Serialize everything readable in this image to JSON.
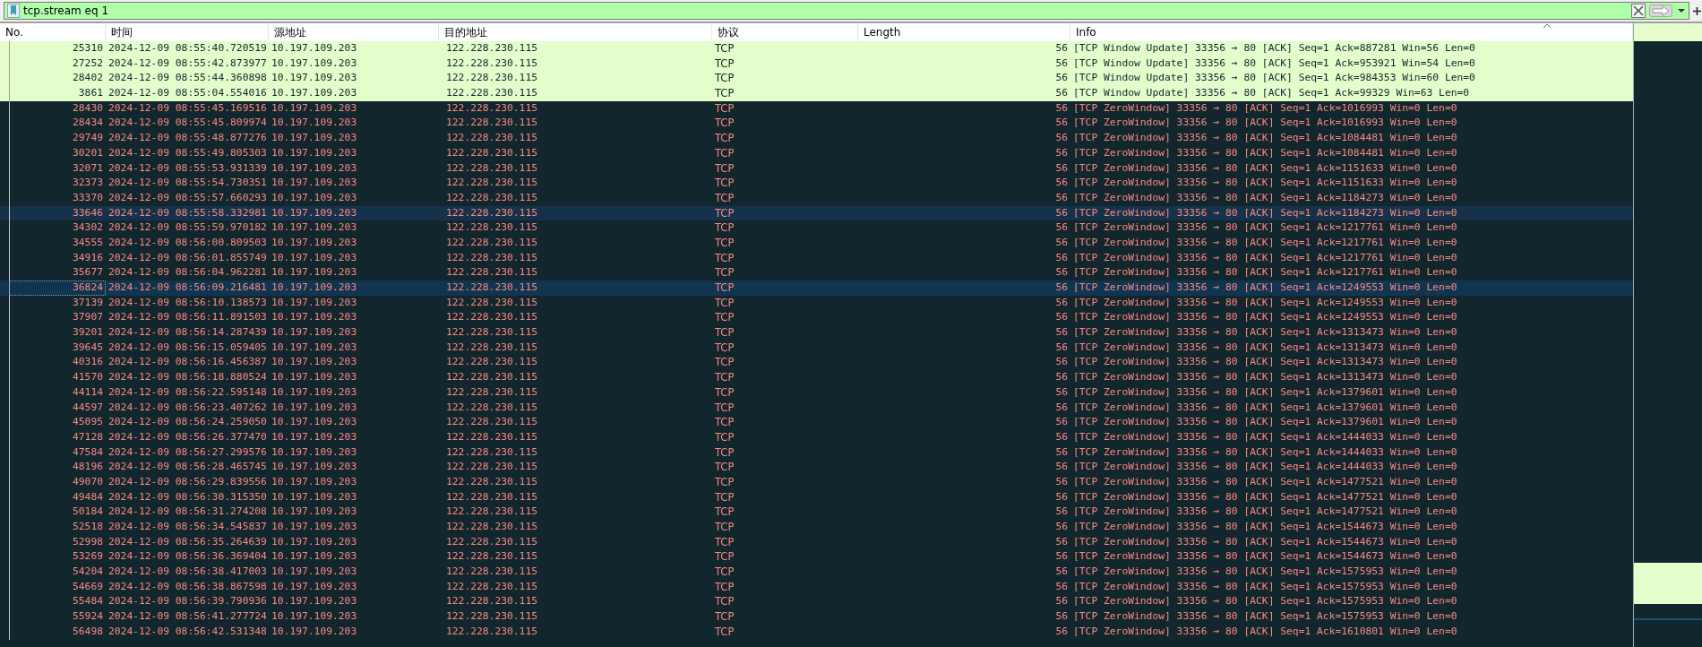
{
  "filter": {
    "value": "tcp.stream eq 1"
  },
  "columns": [
    {
      "label": "No.",
      "sorted": false
    },
    {
      "label": "时间",
      "sorted": false
    },
    {
      "label": "源地址",
      "sorted": false
    },
    {
      "label": "目的地址",
      "sorted": false
    },
    {
      "label": "协议",
      "sorted": false
    },
    {
      "label": "Length",
      "sorted": false
    },
    {
      "label": "Info",
      "sorted": true
    }
  ],
  "rows": [
    {
      "no": "25310",
      "time": "2024-12-09 08:55:40.720519",
      "source": "10.197.109.203",
      "destination": "122.228.230.115",
      "protocol": "TCP",
      "length": "56",
      "info": "[TCP Window Update] 33356 → 80 [ACK] Seq=1 Ack=887281 Win=56 Len=0",
      "kind": "update",
      "selected": false,
      "highlighted": false
    },
    {
      "no": "27252",
      "time": "2024-12-09 08:55:42.873977",
      "source": "10.197.109.203",
      "destination": "122.228.230.115",
      "protocol": "TCP",
      "length": "56",
      "info": "[TCP Window Update] 33356 → 80 [ACK] Seq=1 Ack=953921 Win=54 Len=0",
      "kind": "update",
      "selected": false,
      "highlighted": false
    },
    {
      "no": "28402",
      "time": "2024-12-09 08:55:44.360898",
      "source": "10.197.109.203",
      "destination": "122.228.230.115",
      "protocol": "TCP",
      "length": "56",
      "info": "[TCP Window Update] 33356 → 80 [ACK] Seq=1 Ack=984353 Win=60 Len=0",
      "kind": "update",
      "selected": false,
      "highlighted": false
    },
    {
      "no": "3861",
      "time": "2024-12-09 08:55:04.554016",
      "source": "10.197.109.203",
      "destination": "122.228.230.115",
      "protocol": "TCP",
      "length": "56",
      "info": "[TCP Window Update] 33356 → 80 [ACK] Seq=1 Ack=99329 Win=63 Len=0",
      "kind": "update",
      "selected": false,
      "highlighted": false
    },
    {
      "no": "28430",
      "time": "2024-12-09 08:55:45.169516",
      "source": "10.197.109.203",
      "destination": "122.228.230.115",
      "protocol": "TCP",
      "length": "56",
      "info": "[TCP ZeroWindow] 33356 → 80 [ACK] Seq=1 Ack=1016993 Win=0 Len=0",
      "kind": "zero",
      "selected": false,
      "highlighted": false
    },
    {
      "no": "28434",
      "time": "2024-12-09 08:55:45.809974",
      "source": "10.197.109.203",
      "destination": "122.228.230.115",
      "protocol": "TCP",
      "length": "56",
      "info": "[TCP ZeroWindow] 33356 → 80 [ACK] Seq=1 Ack=1016993 Win=0 Len=0",
      "kind": "zero",
      "selected": false,
      "highlighted": false
    },
    {
      "no": "29749",
      "time": "2024-12-09 08:55:48.877276",
      "source": "10.197.109.203",
      "destination": "122.228.230.115",
      "protocol": "TCP",
      "length": "56",
      "info": "[TCP ZeroWindow] 33356 → 80 [ACK] Seq=1 Ack=1084481 Win=0 Len=0",
      "kind": "zero",
      "selected": false,
      "highlighted": false
    },
    {
      "no": "30201",
      "time": "2024-12-09 08:55:49.805303",
      "source": "10.197.109.203",
      "destination": "122.228.230.115",
      "protocol": "TCP",
      "length": "56",
      "info": "[TCP ZeroWindow] 33356 → 80 [ACK] Seq=1 Ack=1084481 Win=0 Len=0",
      "kind": "zero",
      "selected": false,
      "highlighted": false
    },
    {
      "no": "32071",
      "time": "2024-12-09 08:55:53.931339",
      "source": "10.197.109.203",
      "destination": "122.228.230.115",
      "protocol": "TCP",
      "length": "56",
      "info": "[TCP ZeroWindow] 33356 → 80 [ACK] Seq=1 Ack=1151633 Win=0 Len=0",
      "kind": "zero",
      "selected": false,
      "highlighted": false
    },
    {
      "no": "32373",
      "time": "2024-12-09 08:55:54.730351",
      "source": "10.197.109.203",
      "destination": "122.228.230.115",
      "protocol": "TCP",
      "length": "56",
      "info": "[TCP ZeroWindow] 33356 → 80 [ACK] Seq=1 Ack=1151633 Win=0 Len=0",
      "kind": "zero",
      "selected": false,
      "highlighted": false
    },
    {
      "no": "33370",
      "time": "2024-12-09 08:55:57.660293",
      "source": "10.197.109.203",
      "destination": "122.228.230.115",
      "protocol": "TCP",
      "length": "56",
      "info": "[TCP ZeroWindow] 33356 → 80 [ACK] Seq=1 Ack=1184273 Win=0 Len=0",
      "kind": "zero",
      "selected": false,
      "highlighted": false
    },
    {
      "no": "33646",
      "time": "2024-12-09 08:55:58.332981",
      "source": "10.197.109.203",
      "destination": "122.228.230.115",
      "protocol": "TCP",
      "length": "56",
      "info": "[TCP ZeroWindow] 33356 → 80 [ACK] Seq=1 Ack=1184273 Win=0 Len=0",
      "kind": "zero",
      "selected": false,
      "highlighted": true
    },
    {
      "no": "34302",
      "time": "2024-12-09 08:55:59.970182",
      "source": "10.197.109.203",
      "destination": "122.228.230.115",
      "protocol": "TCP",
      "length": "56",
      "info": "[TCP ZeroWindow] 33356 → 80 [ACK] Seq=1 Ack=1217761 Win=0 Len=0",
      "kind": "zero",
      "selected": false,
      "highlighted": false
    },
    {
      "no": "34555",
      "time": "2024-12-09 08:56:00.809503",
      "source": "10.197.109.203",
      "destination": "122.228.230.115",
      "protocol": "TCP",
      "length": "56",
      "info": "[TCP ZeroWindow] 33356 → 80 [ACK] Seq=1 Ack=1217761 Win=0 Len=0",
      "kind": "zero",
      "selected": false,
      "highlighted": false
    },
    {
      "no": "34916",
      "time": "2024-12-09 08:56:01.855749",
      "source": "10.197.109.203",
      "destination": "122.228.230.115",
      "protocol": "TCP",
      "length": "56",
      "info": "[TCP ZeroWindow] 33356 → 80 [ACK] Seq=1 Ack=1217761 Win=0 Len=0",
      "kind": "zero",
      "selected": false,
      "highlighted": false
    },
    {
      "no": "35677",
      "time": "2024-12-09 08:56:04.962281",
      "source": "10.197.109.203",
      "destination": "122.228.230.115",
      "protocol": "TCP",
      "length": "56",
      "info": "[TCP ZeroWindow] 33356 → 80 [ACK] Seq=1 Ack=1217761 Win=0 Len=0",
      "kind": "zero",
      "selected": false,
      "highlighted": false
    },
    {
      "no": "36824",
      "time": "2024-12-09 08:56:09.216481",
      "source": "10.197.109.203",
      "destination": "122.228.230.115",
      "protocol": "TCP",
      "length": "56",
      "info": "[TCP ZeroWindow] 33356 → 80 [ACK] Seq=1 Ack=1249553 Win=0 Len=0",
      "kind": "zero",
      "selected": true,
      "highlighted": false
    },
    {
      "no": "37139",
      "time": "2024-12-09 08:56:10.138573",
      "source": "10.197.109.203",
      "destination": "122.228.230.115",
      "protocol": "TCP",
      "length": "56",
      "info": "[TCP ZeroWindow] 33356 → 80 [ACK] Seq=1 Ack=1249553 Win=0 Len=0",
      "kind": "zero",
      "selected": false,
      "highlighted": false
    },
    {
      "no": "37907",
      "time": "2024-12-09 08:56:11.891503",
      "source": "10.197.109.203",
      "destination": "122.228.230.115",
      "protocol": "TCP",
      "length": "56",
      "info": "[TCP ZeroWindow] 33356 → 80 [ACK] Seq=1 Ack=1249553 Win=0 Len=0",
      "kind": "zero",
      "selected": false,
      "highlighted": false
    },
    {
      "no": "39201",
      "time": "2024-12-09 08:56:14.287439",
      "source": "10.197.109.203",
      "destination": "122.228.230.115",
      "protocol": "TCP",
      "length": "56",
      "info": "[TCP ZeroWindow] 33356 → 80 [ACK] Seq=1 Ack=1313473 Win=0 Len=0",
      "kind": "zero",
      "selected": false,
      "highlighted": false
    },
    {
      "no": "39645",
      "time": "2024-12-09 08:56:15.059405",
      "source": "10.197.109.203",
      "destination": "122.228.230.115",
      "protocol": "TCP",
      "length": "56",
      "info": "[TCP ZeroWindow] 33356 → 80 [ACK] Seq=1 Ack=1313473 Win=0 Len=0",
      "kind": "zero",
      "selected": false,
      "highlighted": false
    },
    {
      "no": "40316",
      "time": "2024-12-09 08:56:16.456387",
      "source": "10.197.109.203",
      "destination": "122.228.230.115",
      "protocol": "TCP",
      "length": "56",
      "info": "[TCP ZeroWindow] 33356 → 80 [ACK] Seq=1 Ack=1313473 Win=0 Len=0",
      "kind": "zero",
      "selected": false,
      "highlighted": false
    },
    {
      "no": "41570",
      "time": "2024-12-09 08:56:18.880524",
      "source": "10.197.109.203",
      "destination": "122.228.230.115",
      "protocol": "TCP",
      "length": "56",
      "info": "[TCP ZeroWindow] 33356 → 80 [ACK] Seq=1 Ack=1313473 Win=0 Len=0",
      "kind": "zero",
      "selected": false,
      "highlighted": false
    },
    {
      "no": "44114",
      "time": "2024-12-09 08:56:22.595148",
      "source": "10.197.109.203",
      "destination": "122.228.230.115",
      "protocol": "TCP",
      "length": "56",
      "info": "[TCP ZeroWindow] 33356 → 80 [ACK] Seq=1 Ack=1379601 Win=0 Len=0",
      "kind": "zero",
      "selected": false,
      "highlighted": false
    },
    {
      "no": "44597",
      "time": "2024-12-09 08:56:23.407262",
      "source": "10.197.109.203",
      "destination": "122.228.230.115",
      "protocol": "TCP",
      "length": "56",
      "info": "[TCP ZeroWindow] 33356 → 80 [ACK] Seq=1 Ack=1379601 Win=0 Len=0",
      "kind": "zero",
      "selected": false,
      "highlighted": false
    },
    {
      "no": "45095",
      "time": "2024-12-09 08:56:24.259050",
      "source": "10.197.109.203",
      "destination": "122.228.230.115",
      "protocol": "TCP",
      "length": "56",
      "info": "[TCP ZeroWindow] 33356 → 80 [ACK] Seq=1 Ack=1379601 Win=0 Len=0",
      "kind": "zero",
      "selected": false,
      "highlighted": false
    },
    {
      "no": "47128",
      "time": "2024-12-09 08:56:26.377470",
      "source": "10.197.109.203",
      "destination": "122.228.230.115",
      "protocol": "TCP",
      "length": "56",
      "info": "[TCP ZeroWindow] 33356 → 80 [ACK] Seq=1 Ack=1444033 Win=0 Len=0",
      "kind": "zero",
      "selected": false,
      "highlighted": false
    },
    {
      "no": "47584",
      "time": "2024-12-09 08:56:27.299576",
      "source": "10.197.109.203",
      "destination": "122.228.230.115",
      "protocol": "TCP",
      "length": "56",
      "info": "[TCP ZeroWindow] 33356 → 80 [ACK] Seq=1 Ack=1444033 Win=0 Len=0",
      "kind": "zero",
      "selected": false,
      "highlighted": false
    },
    {
      "no": "48196",
      "time": "2024-12-09 08:56:28.465745",
      "source": "10.197.109.203",
      "destination": "122.228.230.115",
      "protocol": "TCP",
      "length": "56",
      "info": "[TCP ZeroWindow] 33356 → 80 [ACK] Seq=1 Ack=1444033 Win=0 Len=0",
      "kind": "zero",
      "selected": false,
      "highlighted": false
    },
    {
      "no": "49070",
      "time": "2024-12-09 08:56:29.839556",
      "source": "10.197.109.203",
      "destination": "122.228.230.115",
      "protocol": "TCP",
      "length": "56",
      "info": "[TCP ZeroWindow] 33356 → 80 [ACK] Seq=1 Ack=1477521 Win=0 Len=0",
      "kind": "zero",
      "selected": false,
      "highlighted": false
    },
    {
      "no": "49484",
      "time": "2024-12-09 08:56:30.315350",
      "source": "10.197.109.203",
      "destination": "122.228.230.115",
      "protocol": "TCP",
      "length": "56",
      "info": "[TCP ZeroWindow] 33356 → 80 [ACK] Seq=1 Ack=1477521 Win=0 Len=0",
      "kind": "zero",
      "selected": false,
      "highlighted": false
    },
    {
      "no": "50184",
      "time": "2024-12-09 08:56:31.274208",
      "source": "10.197.109.203",
      "destination": "122.228.230.115",
      "protocol": "TCP",
      "length": "56",
      "info": "[TCP ZeroWindow] 33356 → 80 [ACK] Seq=1 Ack=1477521 Win=0 Len=0",
      "kind": "zero",
      "selected": false,
      "highlighted": false
    },
    {
      "no": "52518",
      "time": "2024-12-09 08:56:34.545837",
      "source": "10.197.109.203",
      "destination": "122.228.230.115",
      "protocol": "TCP",
      "length": "56",
      "info": "[TCP ZeroWindow] 33356 → 80 [ACK] Seq=1 Ack=1544673 Win=0 Len=0",
      "kind": "zero",
      "selected": false,
      "highlighted": false
    },
    {
      "no": "52998",
      "time": "2024-12-09 08:56:35.264639",
      "source": "10.197.109.203",
      "destination": "122.228.230.115",
      "protocol": "TCP",
      "length": "56",
      "info": "[TCP ZeroWindow] 33356 → 80 [ACK] Seq=1 Ack=1544673 Win=0 Len=0",
      "kind": "zero",
      "selected": false,
      "highlighted": false
    },
    {
      "no": "53269",
      "time": "2024-12-09 08:56:36.369404",
      "source": "10.197.109.203",
      "destination": "122.228.230.115",
      "protocol": "TCP",
      "length": "56",
      "info": "[TCP ZeroWindow] 33356 → 80 [ACK] Seq=1 Ack=1544673 Win=0 Len=0",
      "kind": "zero",
      "selected": false,
      "highlighted": false
    },
    {
      "no": "54204",
      "time": "2024-12-09 08:56:38.417003",
      "source": "10.197.109.203",
      "destination": "122.228.230.115",
      "protocol": "TCP",
      "length": "56",
      "info": "[TCP ZeroWindow] 33356 → 80 [ACK] Seq=1 Ack=1575953 Win=0 Len=0",
      "kind": "zero",
      "selected": false,
      "highlighted": false
    },
    {
      "no": "54669",
      "time": "2024-12-09 08:56:38.867598",
      "source": "10.197.109.203",
      "destination": "122.228.230.115",
      "protocol": "TCP",
      "length": "56",
      "info": "[TCP ZeroWindow] 33356 → 80 [ACK] Seq=1 Ack=1575953 Win=0 Len=0",
      "kind": "zero",
      "selected": false,
      "highlighted": false
    },
    {
      "no": "55484",
      "time": "2024-12-09 08:56:39.790936",
      "source": "10.197.109.203",
      "destination": "122.228.230.115",
      "protocol": "TCP",
      "length": "56",
      "info": "[TCP ZeroWindow] 33356 → 80 [ACK] Seq=1 Ack=1575953 Win=0 Len=0",
      "kind": "zero",
      "selected": false,
      "highlighted": false
    },
    {
      "no": "55924",
      "time": "2024-12-09 08:56:41.277724",
      "source": "10.197.109.203",
      "destination": "122.228.230.115",
      "protocol": "TCP",
      "length": "56",
      "info": "[TCP ZeroWindow] 33356 → 80 [ACK] Seq=1 Ack=1575953 Win=0 Len=0",
      "kind": "zero",
      "selected": false,
      "highlighted": false
    },
    {
      "no": "56498",
      "time": "2024-12-09 08:56:42.531348",
      "source": "10.197.109.203",
      "destination": "122.228.230.115",
      "protocol": "TCP",
      "length": "56",
      "info": "[TCP ZeroWindow] 33356 → 80 [ACK] Seq=1 Ack=1610801 Win=0 Len=0",
      "kind": "zero",
      "selected": false,
      "highlighted": false
    }
  ]
}
